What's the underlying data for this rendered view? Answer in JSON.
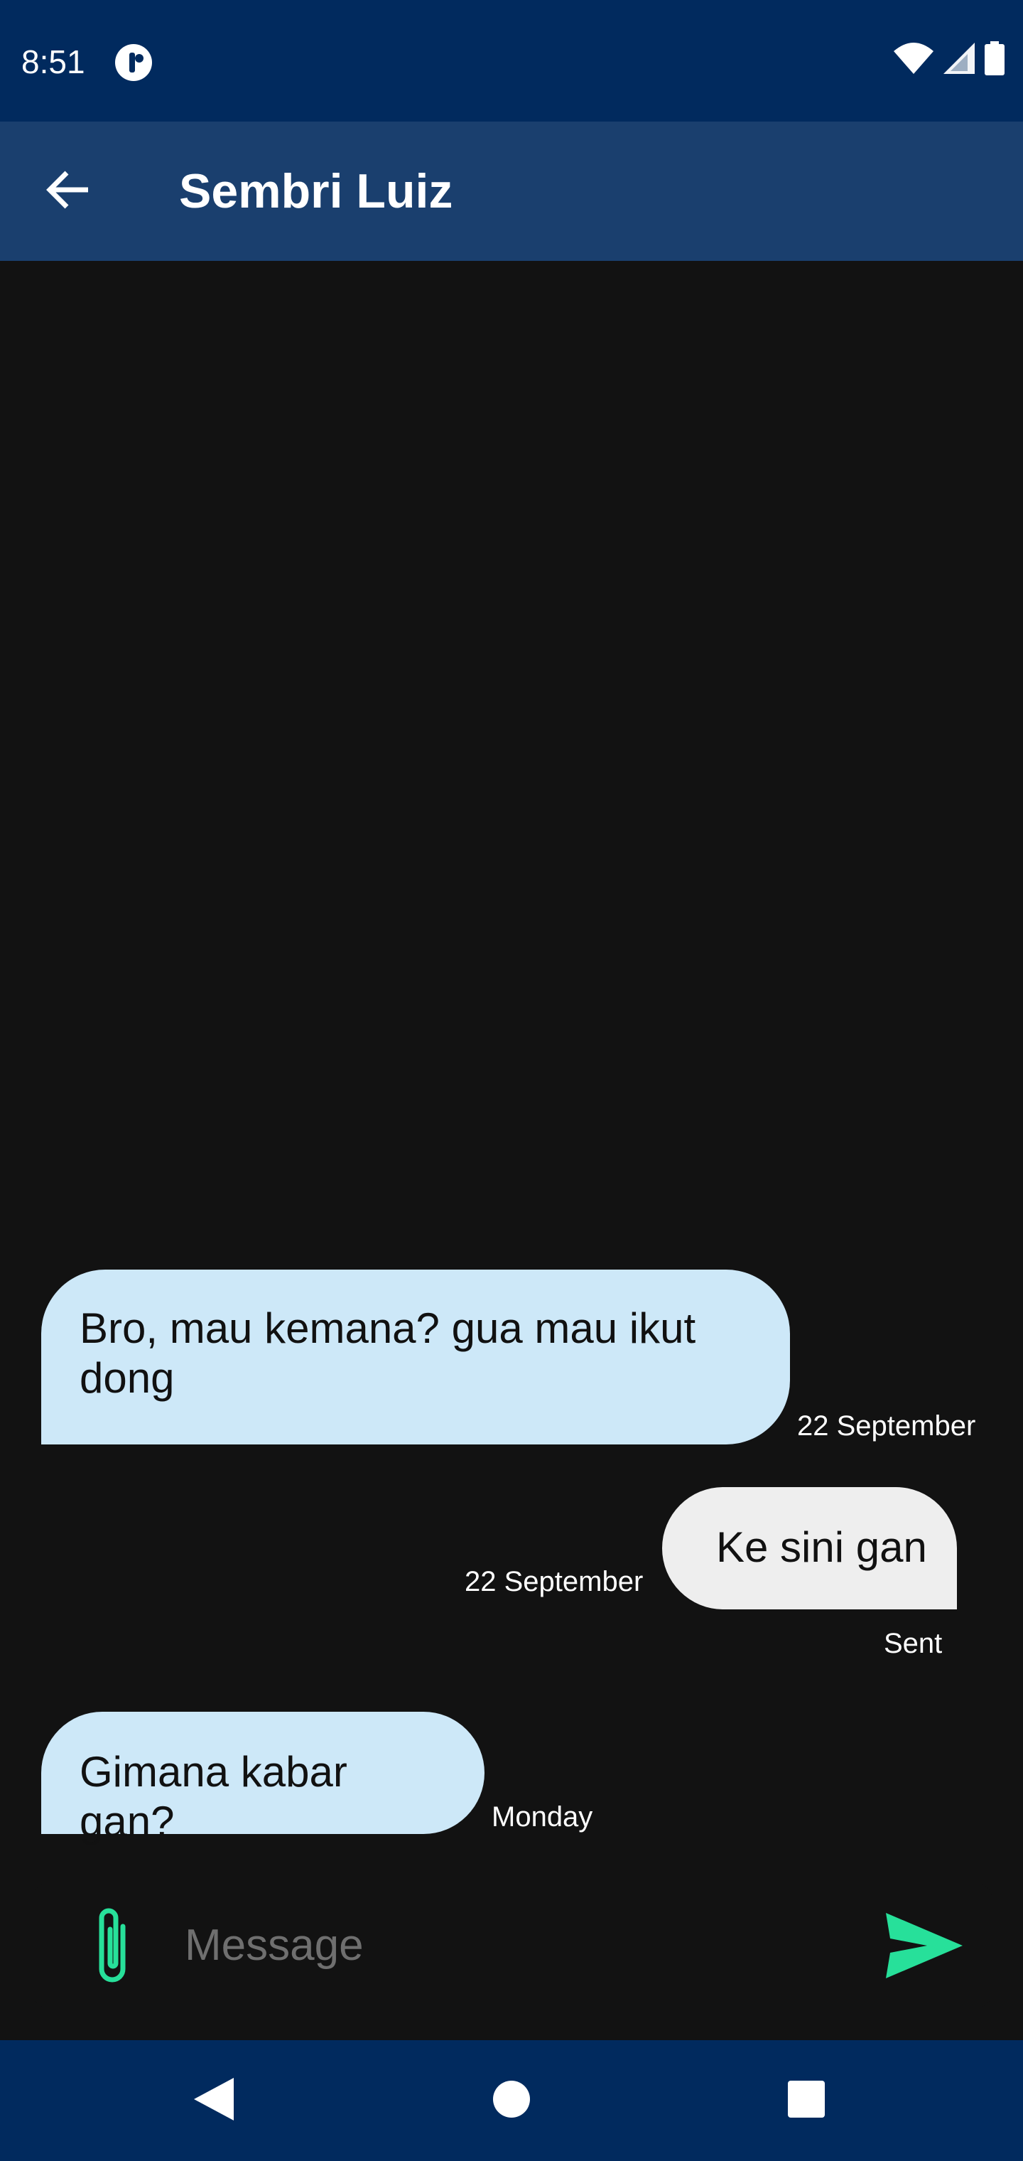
{
  "status_bar": {
    "time": "8:51",
    "icons": [
      "app-notification-icon",
      "wifi-icon",
      "cell-signal-icon",
      "battery-icon"
    ]
  },
  "app_bar": {
    "title": "Sembri Luiz",
    "back_icon": "arrow-back-icon"
  },
  "messages": [
    {
      "direction": "incoming",
      "text": "Bro, mau kemana? gua mau ikut dong",
      "date": "22 September",
      "status": ""
    },
    {
      "direction": "outgoing",
      "text": "Ke sini gan",
      "date": "22 September",
      "status": "Sent"
    },
    {
      "direction": "incoming",
      "text": "Gimana kabar gan?",
      "date": "Monday",
      "status": ""
    }
  ],
  "composer": {
    "placeholder": "Message",
    "value": "",
    "attach_icon": "paperclip-icon",
    "send_icon": "send-icon"
  },
  "nav_bar": {
    "icons": [
      "back-triangle-icon",
      "home-circle-icon",
      "recents-square-icon"
    ]
  },
  "colors": {
    "status_bar": "#012a5e",
    "app_bar": "#1a3f6e",
    "background": "#121212",
    "incoming_bubble": "#cde8f8",
    "outgoing_bubble": "#eeeeee",
    "accent": "#27e09a"
  }
}
